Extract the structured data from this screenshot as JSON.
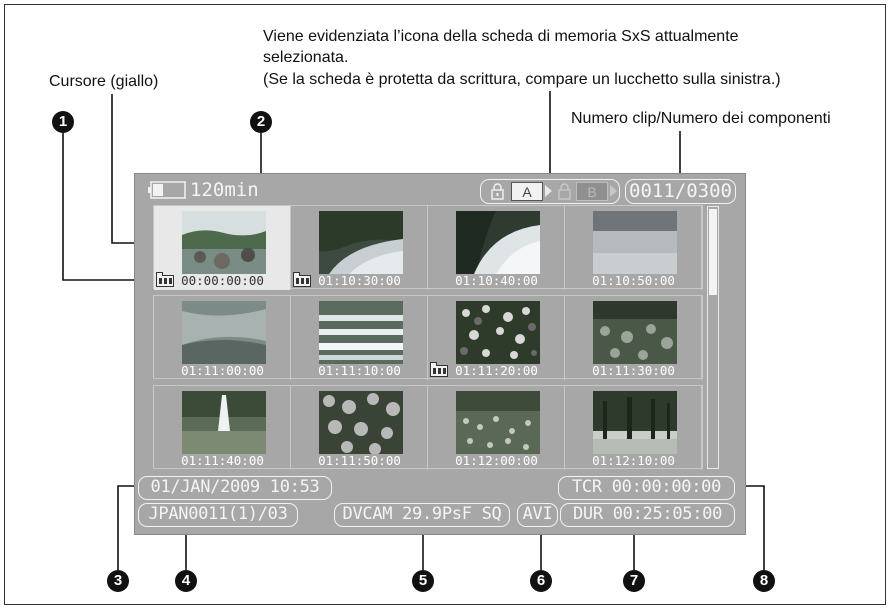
{
  "annotations": {
    "cursor": "Cursore (giallo)",
    "card_highlight_line1": "Viene evidenziata l’icona della scheda di memoria SxS attualmente",
    "card_highlight_line2": "selezionata.",
    "card_highlight_line3": "(Se la scheda è protetta da scrittura, compare un lucchetto sulla sinistra.)",
    "clip_number": "Numero clip/Numero dei componenti"
  },
  "callouts": [
    "1",
    "2",
    "3",
    "4",
    "5",
    "6",
    "7",
    "8"
  ],
  "screen": {
    "battery_remaining": "120min",
    "slot_a": "A",
    "slot_b": "B",
    "clip_counter": "0011/0300",
    "selected_thumbnail_index": 0,
    "thumbnails": [
      {
        "timecode": "00:00:00:00",
        "clip_icon": true,
        "scene": "river-rocks"
      },
      {
        "timecode": "01:10:30:00",
        "clip_icon": true,
        "scene": "river-reflection"
      },
      {
        "timecode": "01:10:40:00",
        "clip_icon": false,
        "scene": "river-bright"
      },
      {
        "timecode": "01:10:50:00",
        "clip_icon": false,
        "scene": "water-surface"
      },
      {
        "timecode": "01:11:00:00",
        "clip_icon": false,
        "scene": "rapids"
      },
      {
        "timecode": "01:11:10:00",
        "clip_icon": false,
        "scene": "cascade"
      },
      {
        "timecode": "01:11:20:00",
        "clip_icon": true,
        "scene": "flower-field"
      },
      {
        "timecode": "01:11:30:00",
        "clip_icon": false,
        "scene": "garden"
      },
      {
        "timecode": "01:11:40:00",
        "clip_icon": false,
        "scene": "fountain"
      },
      {
        "timecode": "01:11:50:00",
        "clip_icon": false,
        "scene": "flowers-closeup"
      },
      {
        "timecode": "01:12:00:00",
        "clip_icon": false,
        "scene": "flower-bed"
      },
      {
        "timecode": "01:12:10:00",
        "clip_icon": false,
        "scene": "trees"
      }
    ],
    "date_time": "01/JAN/2009 10:53",
    "clip_name": "JPAN0011(1)/03",
    "video_format": "DVCAM 29.9PsF SQ",
    "file_type": "AVI",
    "tcr": "TCR 00:00:00:00",
    "duration": "DUR 00:25:05:00"
  }
}
